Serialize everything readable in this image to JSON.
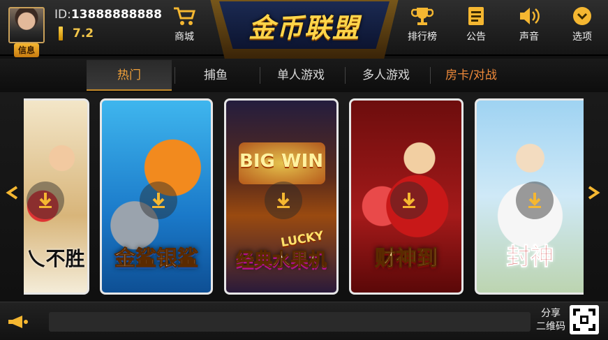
{
  "user": {
    "id_prefix": "ID:",
    "id": "13888888888",
    "coins": "7.2",
    "info_label": "信息"
  },
  "header": {
    "shop_label": "商城",
    "logo": "金币联盟"
  },
  "nav": [
    {
      "label": "排行榜",
      "icon": "trophy-icon"
    },
    {
      "label": "公告",
      "icon": "notice-icon"
    },
    {
      "label": "声音",
      "icon": "speaker-icon"
    },
    {
      "label": "选项",
      "icon": "options-icon"
    }
  ],
  "tabs": [
    {
      "label": "热门",
      "state": "active"
    },
    {
      "label": "捕鱼"
    },
    {
      "label": "单人游戏"
    },
    {
      "label": "多人游戏"
    },
    {
      "label": "房卡/对战",
      "state": "special"
    }
  ],
  "games": [
    {
      "title": "乀不胜",
      "bg": "partial"
    },
    {
      "title": "金鲨银鲨"
    },
    {
      "title": "经典水果机",
      "badge": "LUCKY",
      "overlay": "BIG WIN"
    },
    {
      "title": "财神到"
    },
    {
      "title": "封神"
    }
  ],
  "footer": {
    "share_line1": "分享",
    "share_line2": "二维码"
  },
  "colors": {
    "accent": "#f0a03a",
    "gold": "#ffd54a",
    "card_border": "#e7e7e7"
  }
}
